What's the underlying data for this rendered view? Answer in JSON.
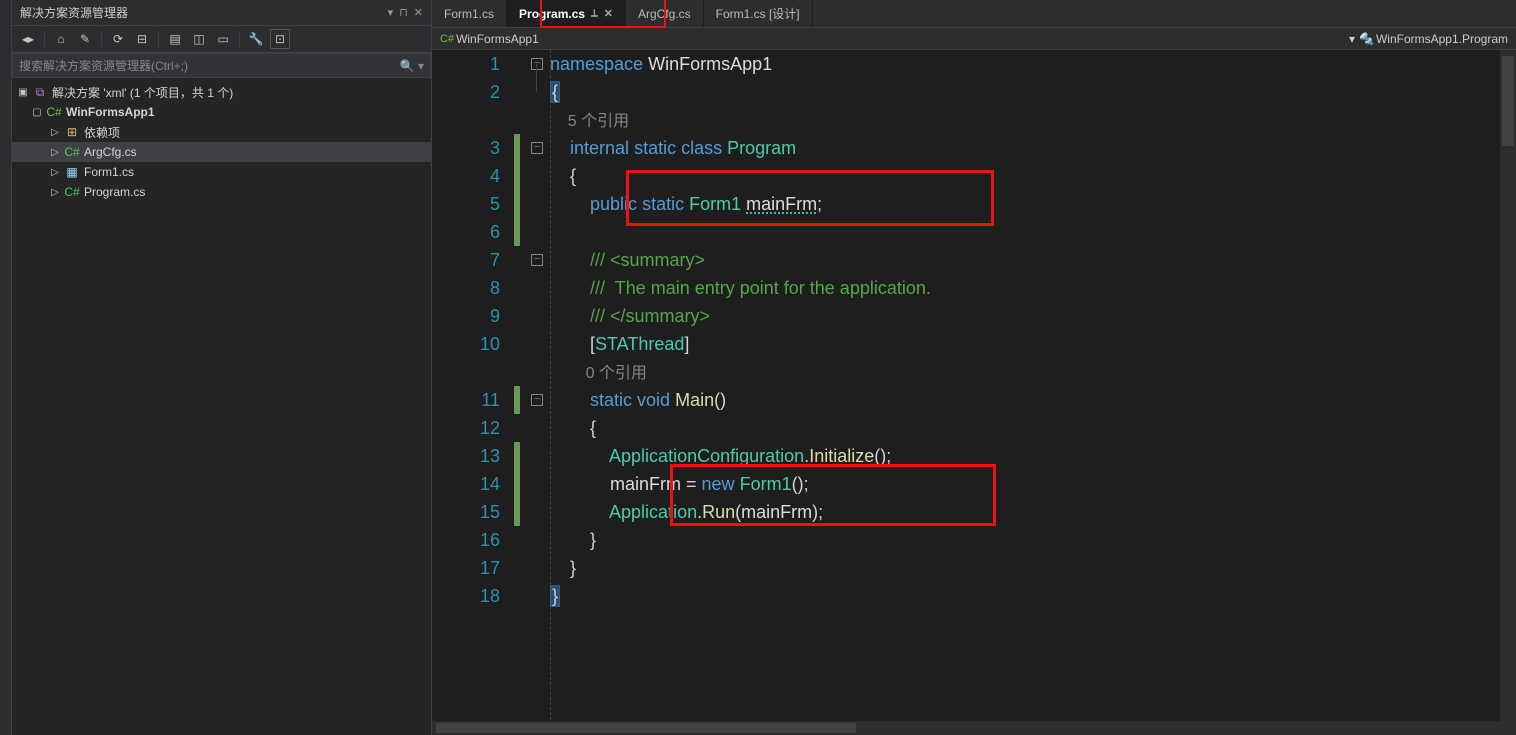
{
  "panel": {
    "title": "解决方案资源管理器",
    "search_placeholder": "搜索解决方案资源管理器(Ctrl+;)"
  },
  "tree": {
    "solution": "解决方案 'xml' (1 个项目，共 1 个)",
    "project": "WinFormsApp1",
    "items": [
      {
        "name": "依赖项",
        "kind": "dep"
      },
      {
        "name": "ArgCfg.cs",
        "kind": "cs",
        "selected": true
      },
      {
        "name": "Form1.cs",
        "kind": "form"
      },
      {
        "name": "Program.cs",
        "kind": "cs"
      }
    ]
  },
  "tabs": [
    {
      "label": "Form1.cs",
      "active": false
    },
    {
      "label": "Program.cs",
      "active": true,
      "pinned": true
    },
    {
      "label": "ArgCfg.cs",
      "active": false
    },
    {
      "label": "Form1.cs [设计]",
      "active": false
    }
  ],
  "breadcrumb": {
    "left": "WinFormsApp1",
    "right": "WinFormsApp1.Program"
  },
  "code": {
    "ref1": "5 个引用",
    "ref2": "0 个引用",
    "l1_ns": "namespace",
    "l1_name": "WinFormsApp1",
    "l3_int": "internal",
    "l3_stat": "static",
    "l3_cls": "class",
    "l3_name": "Program",
    "l5_pub": "public",
    "l5_stat": "static",
    "l5_type": "Form1",
    "l5_var": "mainFrm",
    "l7_c": "/// <summary>",
    "l8_c": "///  The main entry point for the application.",
    "l9_c": "/// </summary>",
    "l10_a": "STAThread",
    "l11_stat": "static",
    "l11_void": "void",
    "l11_name": "Main",
    "l13_t": "ApplicationConfiguration",
    "l13_m": "Initialize",
    "l14_v": "mainFrm",
    "l14_new": "new",
    "l14_t": "Form1",
    "l15_t": "Application",
    "l15_m": "Run",
    "l15_arg": "mainFrm"
  },
  "line_numbers": [
    "1",
    "2",
    "",
    "3",
    "4",
    "5",
    "6",
    "7",
    "8",
    "9",
    "10",
    "",
    "11",
    "12",
    "13",
    "14",
    "15",
    "16",
    "17",
    "18"
  ]
}
